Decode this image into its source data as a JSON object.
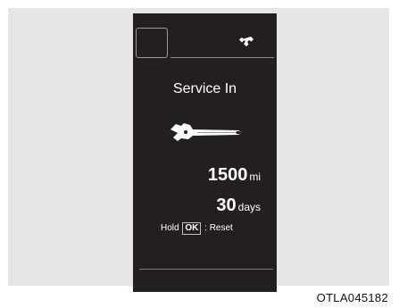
{
  "display": {
    "title": "Service In",
    "top_icon": "wrench-icon",
    "service_icon": "adjustable-wrench-icon",
    "mileage": {
      "value": "1500",
      "unit": "mi"
    },
    "days": {
      "value": "30",
      "unit": "days"
    },
    "hint": {
      "prefix": "Hold",
      "key": "OK",
      "suffix": ": Reset"
    }
  },
  "figure_code": "OTLA045182",
  "colors": {
    "screen": "#231f20",
    "backdrop": "#e6e6e6",
    "text": "#ffffff"
  }
}
